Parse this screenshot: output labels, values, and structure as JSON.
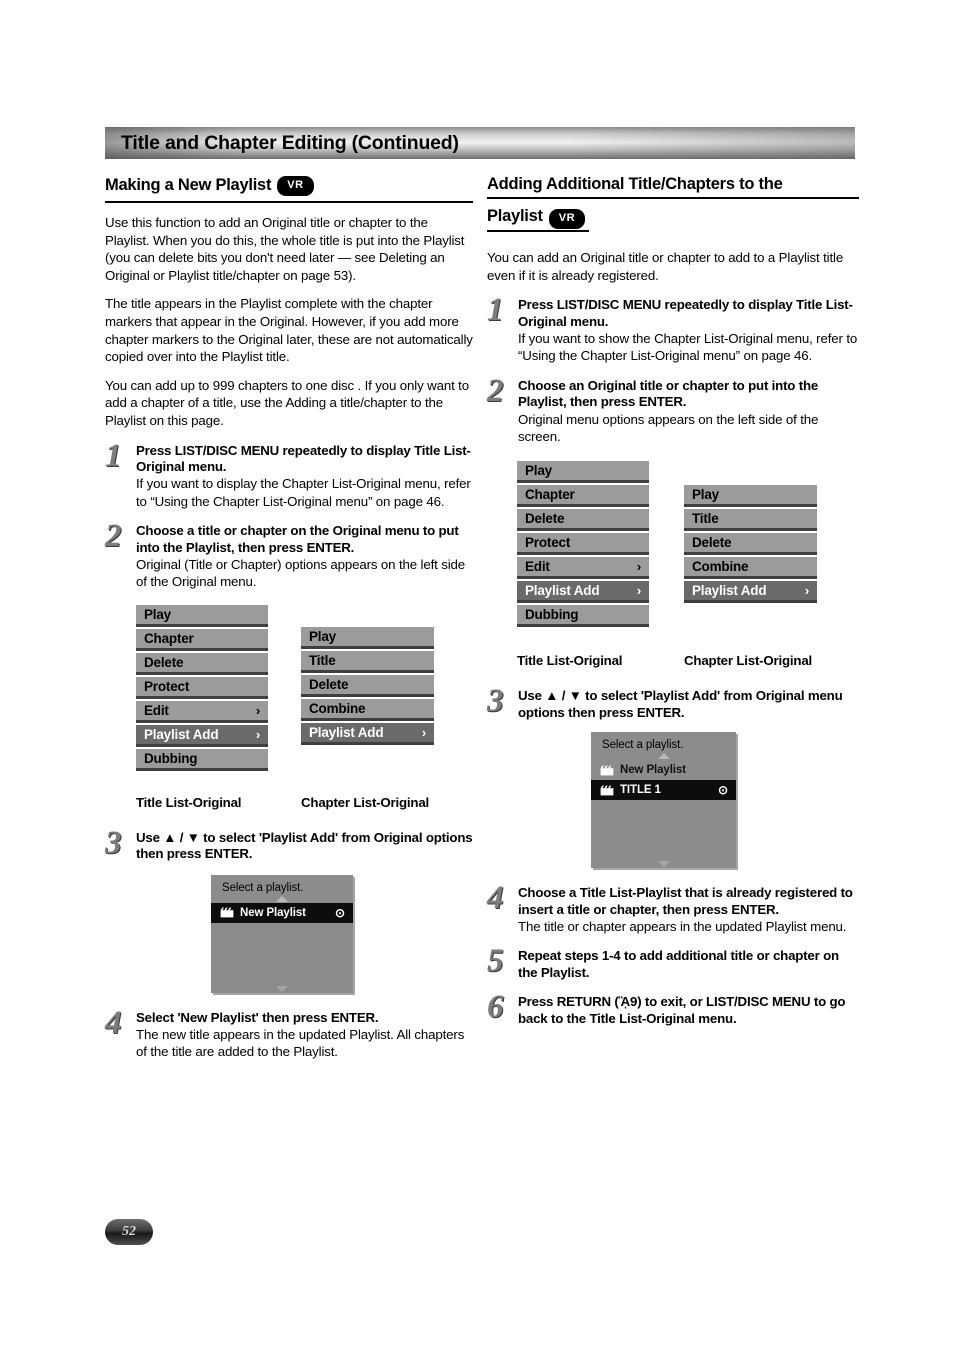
{
  "banner": {
    "title": "Title and Chapter Editing (Continued)"
  },
  "badges": {
    "vr": "VR"
  },
  "page_number": "52",
  "left": {
    "heading": "Making a New Playlist",
    "intro": [
      "Use this function to add an Original title or chapter to the Playlist. When you do this, the whole title is put into the Playlist (you can delete bits you don't need later — see Deleting an Original or Playlist title/chapter on page 53).",
      "The title appears in the Playlist complete with the chapter markers that appear in the Original. However, if you add more chapter markers to the Original later, these are not automatically copied over into the Playlist title.",
      "You can add up to 999 chapters to one disc . If you only want to add a chapter of a title, use the Adding a title/chapter to the Playlist on this page."
    ],
    "steps": [
      {
        "num": "1",
        "head": "Press LIST/DISC MENU repeatedly to display Title List-Original menu.",
        "sub": "If you want to display the Chapter List-Original menu, refer to “Using the Chapter List-Original menu” on page 46."
      },
      {
        "num": "2",
        "head": "Choose a title or chapter on the Original menu to put into the Playlist, then press ENTER.",
        "sub": "Original (Title or Chapter) options appears on the left side of the Original menu."
      },
      {
        "num": "3",
        "head": "Use ▲ / ▼ to select 'Playlist Add' from Original options then press ENTER.",
        "sub": ""
      },
      {
        "num": "4",
        "head": "Select 'New Playlist' then press ENTER.",
        "sub": "The new title appears in the updated Playlist. All chapters of the title are added to the Playlist."
      }
    ],
    "title_menu": {
      "caption": "Title List-Original",
      "items": [
        {
          "label": "Play",
          "arrow": "",
          "selected": false
        },
        {
          "label": "Chapter",
          "arrow": "",
          "selected": false
        },
        {
          "label": "Delete",
          "arrow": "",
          "selected": false
        },
        {
          "label": "Protect",
          "arrow": "",
          "selected": false
        },
        {
          "label": "Edit",
          "arrow": "›",
          "selected": false
        },
        {
          "label": "Playlist Add",
          "arrow": "›",
          "selected": true
        },
        {
          "label": "Dubbing",
          "arrow": "",
          "selected": false
        }
      ]
    },
    "chapter_menu": {
      "caption": "Chapter List-Original",
      "items": [
        {
          "label": "Play",
          "arrow": "",
          "selected": false
        },
        {
          "label": "Title",
          "arrow": "",
          "selected": false
        },
        {
          "label": "Delete",
          "arrow": "",
          "selected": false
        },
        {
          "label": "Combine",
          "arrow": "",
          "selected": false
        },
        {
          "label": "Playlist Add",
          "arrow": "›",
          "selected": true
        }
      ]
    },
    "picker": {
      "title": "Select a playlist.",
      "rows": [
        {
          "label": "New Playlist",
          "highlighted": true,
          "dot": "⊙"
        }
      ]
    }
  },
  "right": {
    "heading_line1": "Adding Additional Title/Chapters to the",
    "heading_line2": "Playlist",
    "intro": [
      "You can add an Original title or chapter to add to a Playlist title even if it is already registered."
    ],
    "steps": [
      {
        "num": "1",
        "head": "Press LIST/DISC MENU repeatedly to display Title List-Original menu.",
        "sub": "If you want to show the Chapter List-Original menu, refer to “Using the Chapter List-Original menu” on page 46."
      },
      {
        "num": "2",
        "head": "Choose an Original title or chapter to put into the Playlist, then press ENTER.",
        "sub": "Original menu options appears on the left side of the screen."
      },
      {
        "num": "3",
        "head": "Use ▲ / ▼ to select 'Playlist Add' from Original menu options then press ENTER.",
        "sub": ""
      },
      {
        "num": "4",
        "head": "Choose a Title List-Playlist that is already registered to insert a title or chapter, then press ENTER.",
        "sub": "The title or chapter appears in the updated Playlist menu."
      },
      {
        "num": "5",
        "head": "Repeat steps 1-4 to add additional title or chapter on the Playlist.",
        "sub": ""
      },
      {
        "num": "6",
        "head": "Press RETURN (ᾋ9) to exit, or LIST/DISC MENU to go back to the Title List-Original menu.",
        "sub": ""
      }
    ],
    "title_menu": {
      "caption": "Title List-Original",
      "items": [
        {
          "label": "Play",
          "arrow": "",
          "selected": false
        },
        {
          "label": "Chapter",
          "arrow": "",
          "selected": false
        },
        {
          "label": "Delete",
          "arrow": "",
          "selected": false
        },
        {
          "label": "Protect",
          "arrow": "",
          "selected": false
        },
        {
          "label": "Edit",
          "arrow": "›",
          "selected": false
        },
        {
          "label": "Playlist Add",
          "arrow": "›",
          "selected": true
        },
        {
          "label": "Dubbing",
          "arrow": "",
          "selected": false
        }
      ]
    },
    "chapter_menu": {
      "caption": "Chapter List-Original",
      "items": [
        {
          "label": "Play",
          "arrow": "",
          "selected": false
        },
        {
          "label": "Title",
          "arrow": "",
          "selected": false
        },
        {
          "label": "Delete",
          "arrow": "",
          "selected": false
        },
        {
          "label": "Combine",
          "arrow": "",
          "selected": false
        },
        {
          "label": "Playlist Add",
          "arrow": "›",
          "selected": true
        }
      ]
    },
    "picker": {
      "title": "Select a playlist.",
      "rows": [
        {
          "label": "New Playlist",
          "highlighted": false,
          "dot": ""
        },
        {
          "label": "TITLE 1",
          "highlighted": true,
          "dot": "⊙"
        }
      ]
    }
  }
}
